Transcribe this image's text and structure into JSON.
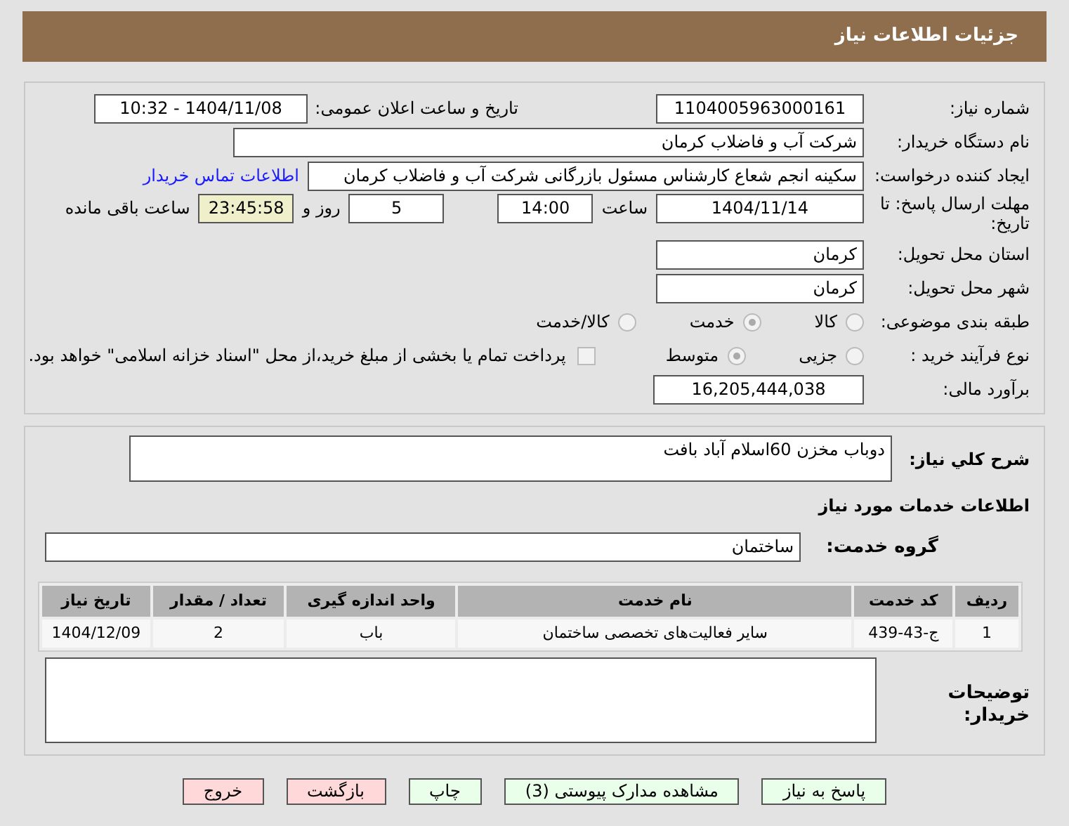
{
  "header": {
    "title": "جزئیات اطلاعات نیاز"
  },
  "need_number": {
    "label": "شماره نیاز:",
    "value": "1104005963000161"
  },
  "announce": {
    "label": "تاریخ و ساعت اعلان عمومی:",
    "value": "1404/11/08 - 10:32"
  },
  "buyer_org": {
    "label": "نام دستگاه خریدار:",
    "value": "شرکت آب و فاضلاب کرمان"
  },
  "requester": {
    "label": "ایجاد کننده درخواست:",
    "value": "سکینه انجم شعاع کارشناس مسئول بازرگانی شرکت آب و فاضلاب کرمان",
    "link": "اطلاعات تماس خریدار"
  },
  "deadline": {
    "label": "مهلت ارسال پاسخ: تا تاریخ:",
    "date": "1404/11/14",
    "time_label": "ساعت",
    "time": "14:00",
    "days": "5",
    "days_label": "روز و",
    "remaining": "23:45:58",
    "remaining_label": "ساعت باقی مانده"
  },
  "province": {
    "label": "استان محل تحویل:",
    "value": "کرمان"
  },
  "city": {
    "label": "شهر محل تحویل:",
    "value": "کرمان"
  },
  "category": {
    "label": "طبقه بندی موضوعی:",
    "options": [
      {
        "label": "کالا",
        "selected": false
      },
      {
        "label": "خدمت",
        "selected": true
      },
      {
        "label": "کالا/خدمت",
        "selected": false
      }
    ]
  },
  "purchase_type": {
    "label": "نوع فرآیند خرید :",
    "options": [
      {
        "label": "جزیی",
        "selected": false
      },
      {
        "label": "متوسط",
        "selected": true
      }
    ],
    "treasury": {
      "label": "پرداخت تمام یا بخشی از مبلغ خرید،از محل \"اسناد خزانه اسلامی\" خواهد بود.",
      "checked": false
    }
  },
  "budget": {
    "label": "برآورد مالی:",
    "value": "16,205,444,038"
  },
  "description": {
    "label": "شرح کلي نياز:",
    "value": "دوباب مخزن 60اسلام آباد بافت"
  },
  "services_title": "اطلاعات خدمات مورد نیاز",
  "service_group": {
    "label": "گروه خدمت:",
    "value": "ساختمان"
  },
  "table": {
    "columns": [
      "ردیف",
      "کد خدمت",
      "نام خدمت",
      "واحد اندازه گیری",
      "تعداد / مقدار",
      "تاریخ نیاز"
    ],
    "rows": [
      [
        "1",
        "ج-43-439",
        "سایر فعالیت‌های تخصصی ساختمان",
        "باب",
        "2",
        "1404/12/09"
      ]
    ]
  },
  "buyer_notes": {
    "label": "توضیحات خریدار:"
  },
  "buttons": [
    {
      "label": "پاسخ به نیاز",
      "color": "#eaffea"
    },
    {
      "label": "مشاهده مدارک پیوستی (3)",
      "color": "#eaffea"
    },
    {
      "label": "چاپ",
      "color": "#eaffea"
    },
    {
      "label": "بازگشت",
      "color": "#ffd9d9"
    },
    {
      "label": "خروج",
      "color": "#ffd9d9"
    }
  ]
}
